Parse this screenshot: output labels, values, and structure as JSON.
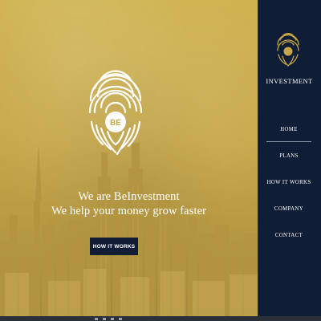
{
  "hero": {
    "tagline_line1": "We are BeInvestment",
    "tagline_line2": "We help your money grow faster",
    "cta_label": "HOW IT WORKS",
    "logo_text": "BE"
  },
  "brand": {
    "name": "INVESTMENT"
  },
  "nav": {
    "items": [
      {
        "label": "HOME",
        "active": true
      },
      {
        "label": "PLANS",
        "active": false
      },
      {
        "label": "HOW IT WORKS",
        "active": false
      },
      {
        "label": "COMPANY",
        "active": false
      },
      {
        "label": "CONTACT",
        "active": false
      }
    ]
  },
  "colors": {
    "hero_gold": "#c6a647",
    "sidebar_navy": "#0f1d36",
    "button_navy": "#111c35",
    "text_white": "#ffffff"
  },
  "icons": {
    "hero_logo": "fingerprint-icon",
    "brand_logo": "fingerprint-emblem-icon"
  }
}
